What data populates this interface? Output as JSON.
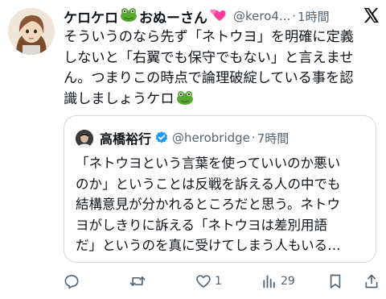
{
  "author": {
    "display_name": "ケロケロ",
    "display_name_suffix": "おぬーさん",
    "handle": "@kero4...",
    "separator": "·",
    "time": "1時間",
    "avatar_icon": "avatar-illustration-icon"
  },
  "tweet": {
    "lines": [
      "そういうのなら先ず「ネトウヨ」を明確に定義",
      "しないと「右翼でも保守でもない」と言えませ",
      "ん。つまりこの時点で論理破綻している事を認",
      "識しましょうケロ"
    ]
  },
  "quoted": {
    "display_name": "高橋裕行",
    "handle": "@herobridge",
    "separator": "·",
    "time": "7時間",
    "lines": [
      "「ネトウヨという言葉を使っていいのか悪い",
      "のか」ということは反戦を訴える人の中でも",
      "結構意見が分かれるところだと思う。ネトウ",
      "ヨがしきりに訴える「ネトウヨは差別用語",
      "だ」というのを真に受けてしまう人もいる…"
    ]
  },
  "actions": {
    "reply_count": "",
    "retweet_count": "",
    "like_count": "1",
    "views_count": "29"
  },
  "colors": {
    "text": "#0f1419",
    "secondary": "#536471",
    "border": "#cfd9de",
    "verified": "#1d9bf0",
    "frog": "#5aa832",
    "hearts": "#ff3d9a"
  }
}
